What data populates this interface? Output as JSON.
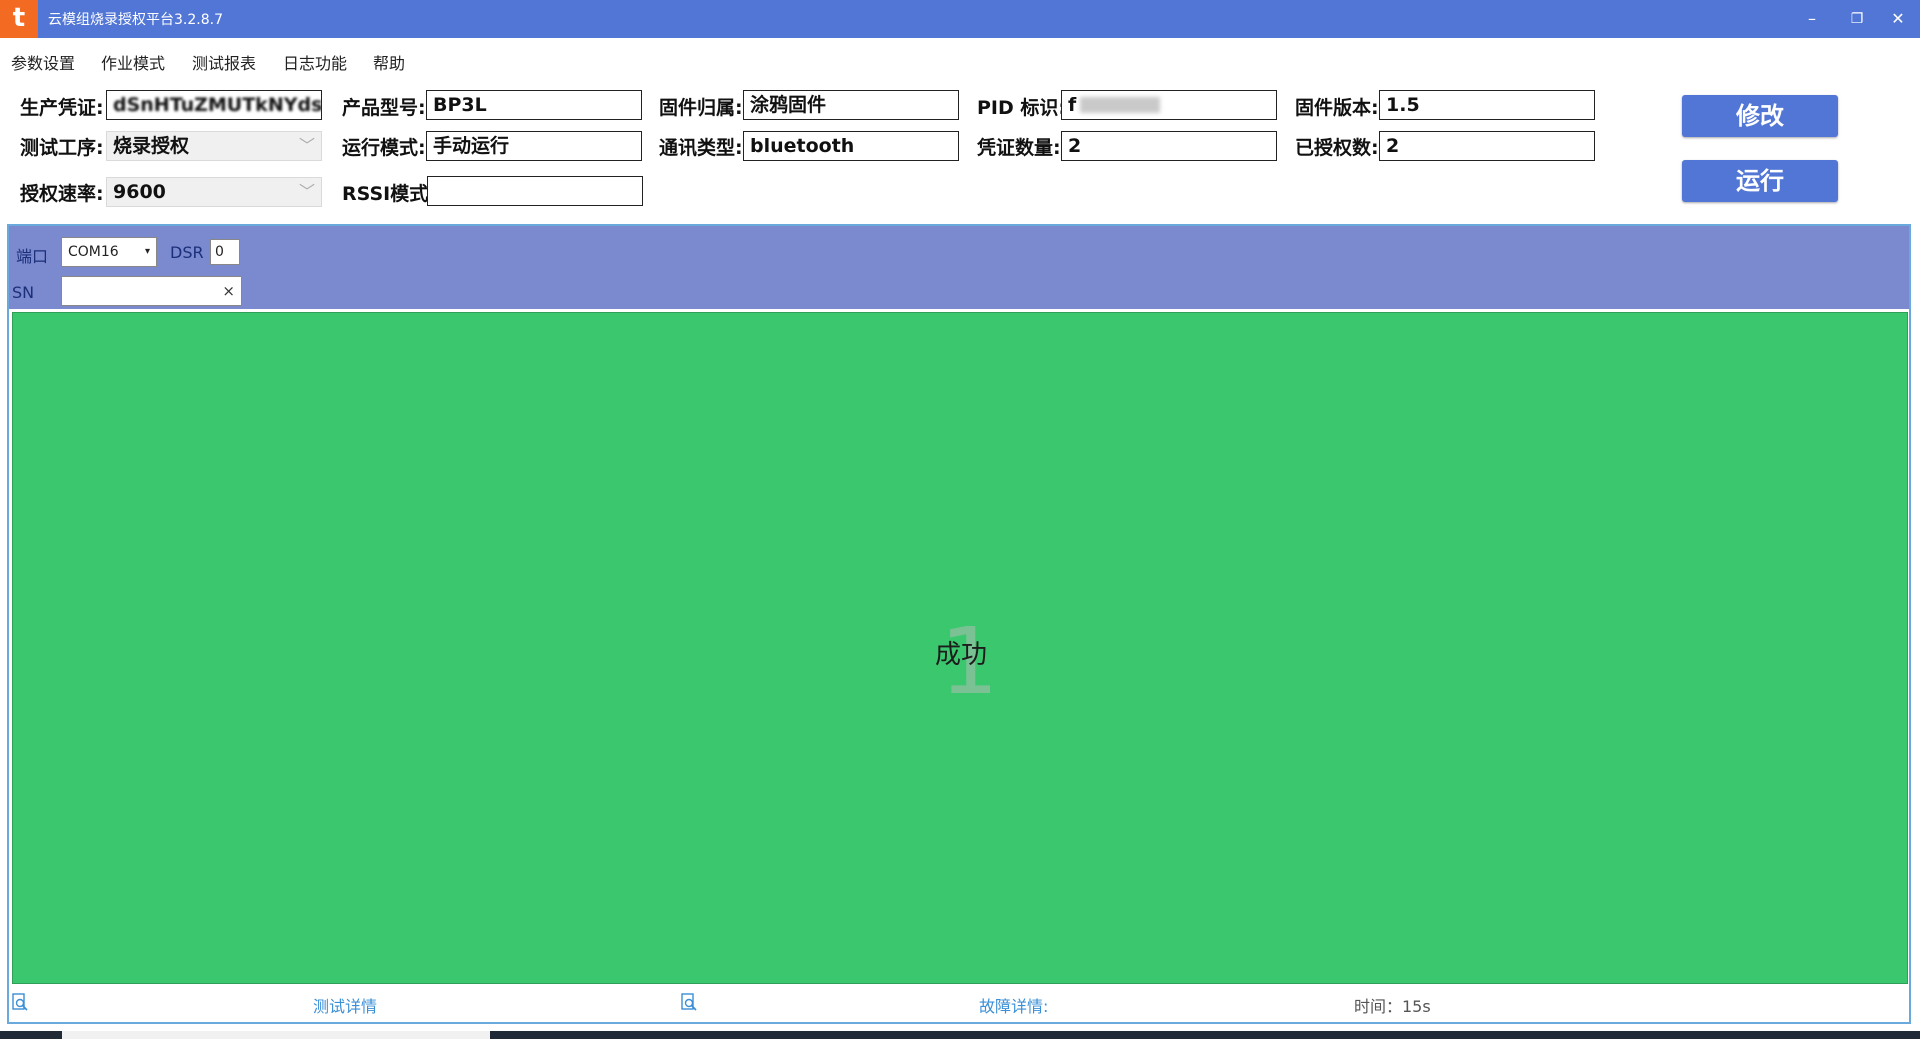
{
  "window": {
    "title": "云模组烧录授权平台3.2.8.7",
    "logo_glyph": "t",
    "controls": {
      "minimize": "–",
      "restore": "❐",
      "close": "✕"
    }
  },
  "menu": [
    "参数设置",
    "作业模式",
    "测试报表",
    "日志功能",
    "帮助"
  ],
  "params": {
    "cert_label": "生产凭证:",
    "cert_value": "dSnHTuZMUTkNYdsq",
    "product_label": "产品型号:",
    "product_value": "BP3L",
    "firmware_owner_label": "固件归属:",
    "firmware_owner_value": "涂鸦固件",
    "pid_label": "PID 标识:",
    "pid_value": "f",
    "fw_version_label": "固件版本:",
    "fw_version_value": "1.5",
    "process_label": "测试工序:",
    "process_value": "烧录授权",
    "run_mode_label": "运行模式:",
    "run_mode_value": "手动运行",
    "comm_type_label": "通讯类型:",
    "comm_type_value": "bluetooth",
    "cert_count_label": "凭证数量:",
    "cert_count_value": "2",
    "authorized_label": "已授权数:",
    "authorized_value": "2",
    "rate_label": "授权速率:",
    "rate_value": "9600",
    "rssi_label": "RSSI模式",
    "rssi_value": ""
  },
  "buttons": {
    "modify": "修改",
    "run": "运行"
  },
  "panel": {
    "port_label": "端口",
    "port_value": "COM16",
    "dsr_label": "DSR",
    "dsr_value": "0",
    "sn_label": "SN",
    "sn_value": "",
    "sn_clear": "×",
    "result_number": "1",
    "result_text": "成功",
    "test_detail_link": "测试详情",
    "fault_detail_link": "故障详情:",
    "time_text": "时间：15s"
  },
  "colors": {
    "titlebar": "#5276d6",
    "logo": "#f36a22",
    "panel_header": "#7b89ce",
    "success": "#3bc76d",
    "link": "#3b8fd6"
  },
  "icons": [
    "app-logo-icon",
    "minimize-icon",
    "restore-icon",
    "close-icon",
    "chevron-down-icon",
    "search-doc-icon",
    "clear-icon"
  ]
}
